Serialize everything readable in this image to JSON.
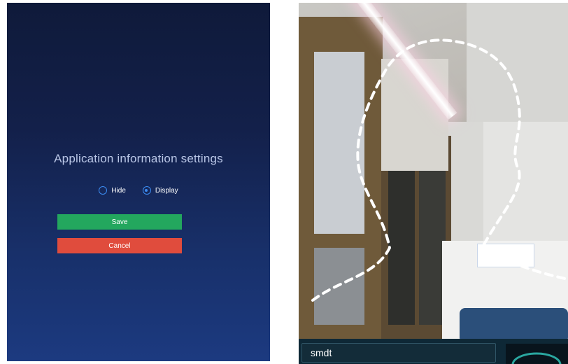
{
  "settings": {
    "title": "Application information settings",
    "options": [
      {
        "label": "Hide",
        "checked": false
      },
      {
        "label": "Display",
        "checked": true
      }
    ],
    "save_label": "Save",
    "cancel_label": "Cancel"
  },
  "camera": {
    "name_value": "smdt"
  },
  "colors": {
    "save": "#23a75e",
    "cancel": "#e04c3d",
    "radio": "#3c8cf2",
    "panel_top": "#0f1a3a",
    "panel_bottom": "#1c3a80"
  }
}
